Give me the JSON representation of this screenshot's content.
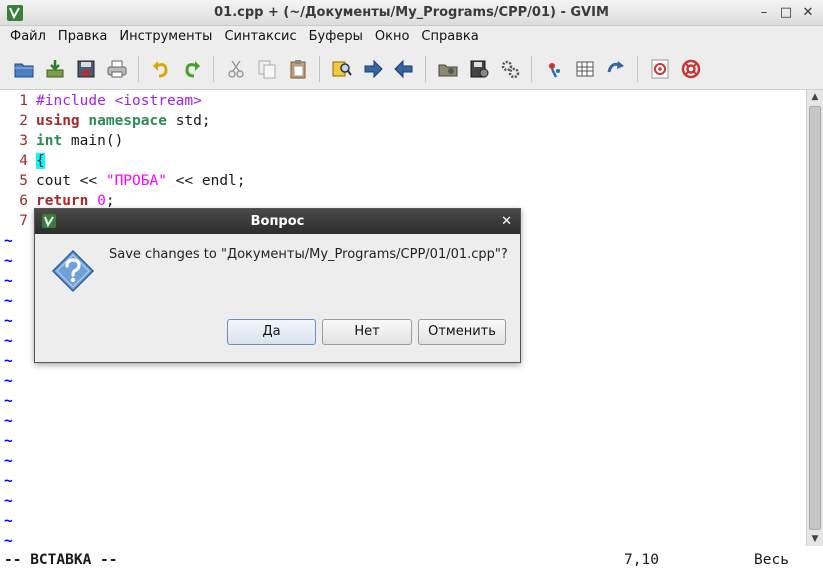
{
  "window": {
    "title": "01.cpp + (~/Документы/My_Programs/CPP/01) - GVIM",
    "minimize": "–",
    "maximize": "□",
    "close": "✕"
  },
  "menu": [
    "Файл",
    "Правка",
    "Инструменты",
    "Синтаксис",
    "Буферы",
    "Окно",
    "Справка"
  ],
  "toolbar_icons": [
    "open-icon",
    "save-icon",
    "save-as-icon",
    "print-icon",
    "undo-icon",
    "redo-icon",
    "cut-icon",
    "copy-icon",
    "paste-icon",
    "find-replace-icon",
    "find-next-icon",
    "find-prev-icon",
    "load-session-icon",
    "save-session-icon",
    "run-script-icon",
    "make-icon",
    "table-icon",
    "jump-tag-icon",
    "help-icon",
    "find-help-icon"
  ],
  "editor": {
    "lines": [
      {
        "num": "1",
        "parts": [
          {
            "t": "#include <iostream>",
            "c": "pp"
          }
        ]
      },
      {
        "num": "2",
        "parts": [
          {
            "t": "using",
            "c": "kw"
          },
          {
            "t": " "
          },
          {
            "t": "namespace",
            "c": "ty"
          },
          {
            "t": " std;"
          }
        ]
      },
      {
        "num": "3",
        "parts": [
          {
            "t": "int",
            "c": "ty"
          },
          {
            "t": " main()"
          }
        ]
      },
      {
        "num": "4",
        "parts": [
          {
            "t": "{",
            "c": "cursor-brace"
          }
        ]
      },
      {
        "num": "5",
        "parts": [
          {
            "t": "cout << "
          },
          {
            "t": "\"ПРОБА\"",
            "c": "str"
          },
          {
            "t": " << endl;"
          }
        ]
      },
      {
        "num": "6",
        "parts": [
          {
            "t": "return",
            "c": "kw"
          },
          {
            "t": " "
          },
          {
            "t": "0",
            "c": "num"
          },
          {
            "t": ";"
          }
        ]
      },
      {
        "num": "7",
        "parts": []
      }
    ],
    "tilde": "~"
  },
  "status": {
    "mode": "-- ВСТАВКА --",
    "position": "7,10",
    "percent": "Весь"
  },
  "dialog": {
    "title": "Вопрос",
    "close": "✕",
    "message": "Save changes to \"Документы/My_Programs/CPP/01/01.cpp\"?",
    "buttons": {
      "yes": "Да",
      "no": "Нет",
      "cancel": "Отменить"
    }
  },
  "colors": {
    "accent_blue": "#3465a4",
    "vim_tilde": "#0000ff"
  }
}
